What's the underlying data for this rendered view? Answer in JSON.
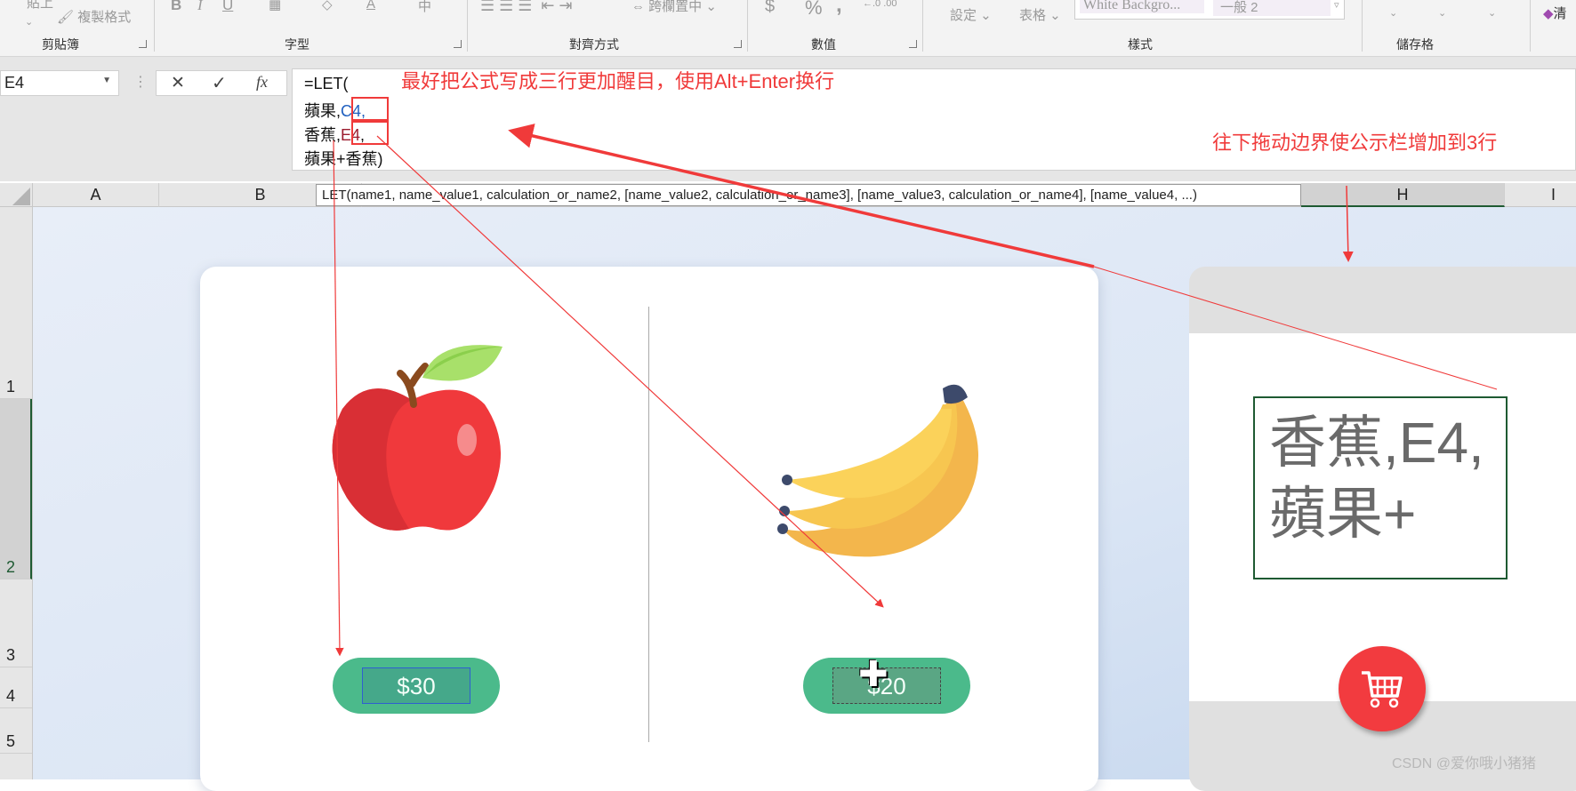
{
  "ribbon": {
    "paste_label": "貼上",
    "format_painter_label": "複製格式",
    "bold": "B",
    "italic": "I",
    "underline": "U",
    "merge_center_label": "跨欄置中",
    "currency": "$",
    "percent": "%",
    "comma": ",",
    "conditional_format_label": "設定",
    "format_as_table_label": "表格",
    "style_1": "White Backgro...",
    "style_2": "一般 2",
    "clear_label": "清",
    "groups": [
      "剪貼簿",
      "字型",
      "對齊方式",
      "數值",
      "樣式",
      "儲存格"
    ]
  },
  "formula_bar": {
    "name_box": "E4",
    "cancel": "✕",
    "enter": "✓",
    "fx": "fx",
    "lines": [
      "=LET(",
      "蘋果,",
      "C4,",
      "香蕉,",
      "E4",
      ",",
      "蘋果+香蕉)"
    ],
    "ref_colors": {
      "C4": "#1f5fbf",
      "E4": "#9b1c2e"
    }
  },
  "annotations": {
    "top": "最好把公式写成三行更加醒目，使用Alt+Enter换行",
    "right": "往下拖动边界使公示栏增加到3行",
    "color": "#f03a3a"
  },
  "tooltip": "LET(name1, name_value1, calculation_or_name2, [name_value2, calculation_or_name3], [name_value3, calculation_or_name4], [name_value4, ...)",
  "columns": [
    "A",
    "B",
    "H",
    "I"
  ],
  "rows": [
    "1",
    "2",
    "3",
    "4",
    "5"
  ],
  "products": [
    {
      "name": "apple",
      "price": "$30"
    },
    {
      "name": "banana",
      "price": "$20"
    }
  ],
  "cell_preview": {
    "line1": "香蕉,E4,",
    "line2": "蘋果+"
  },
  "watermark": "CSDN @爱你哦小猪猪",
  "colors": {
    "pill": "#4bba8b",
    "cart": "#f23b3f",
    "selection": "#1e5a32"
  }
}
